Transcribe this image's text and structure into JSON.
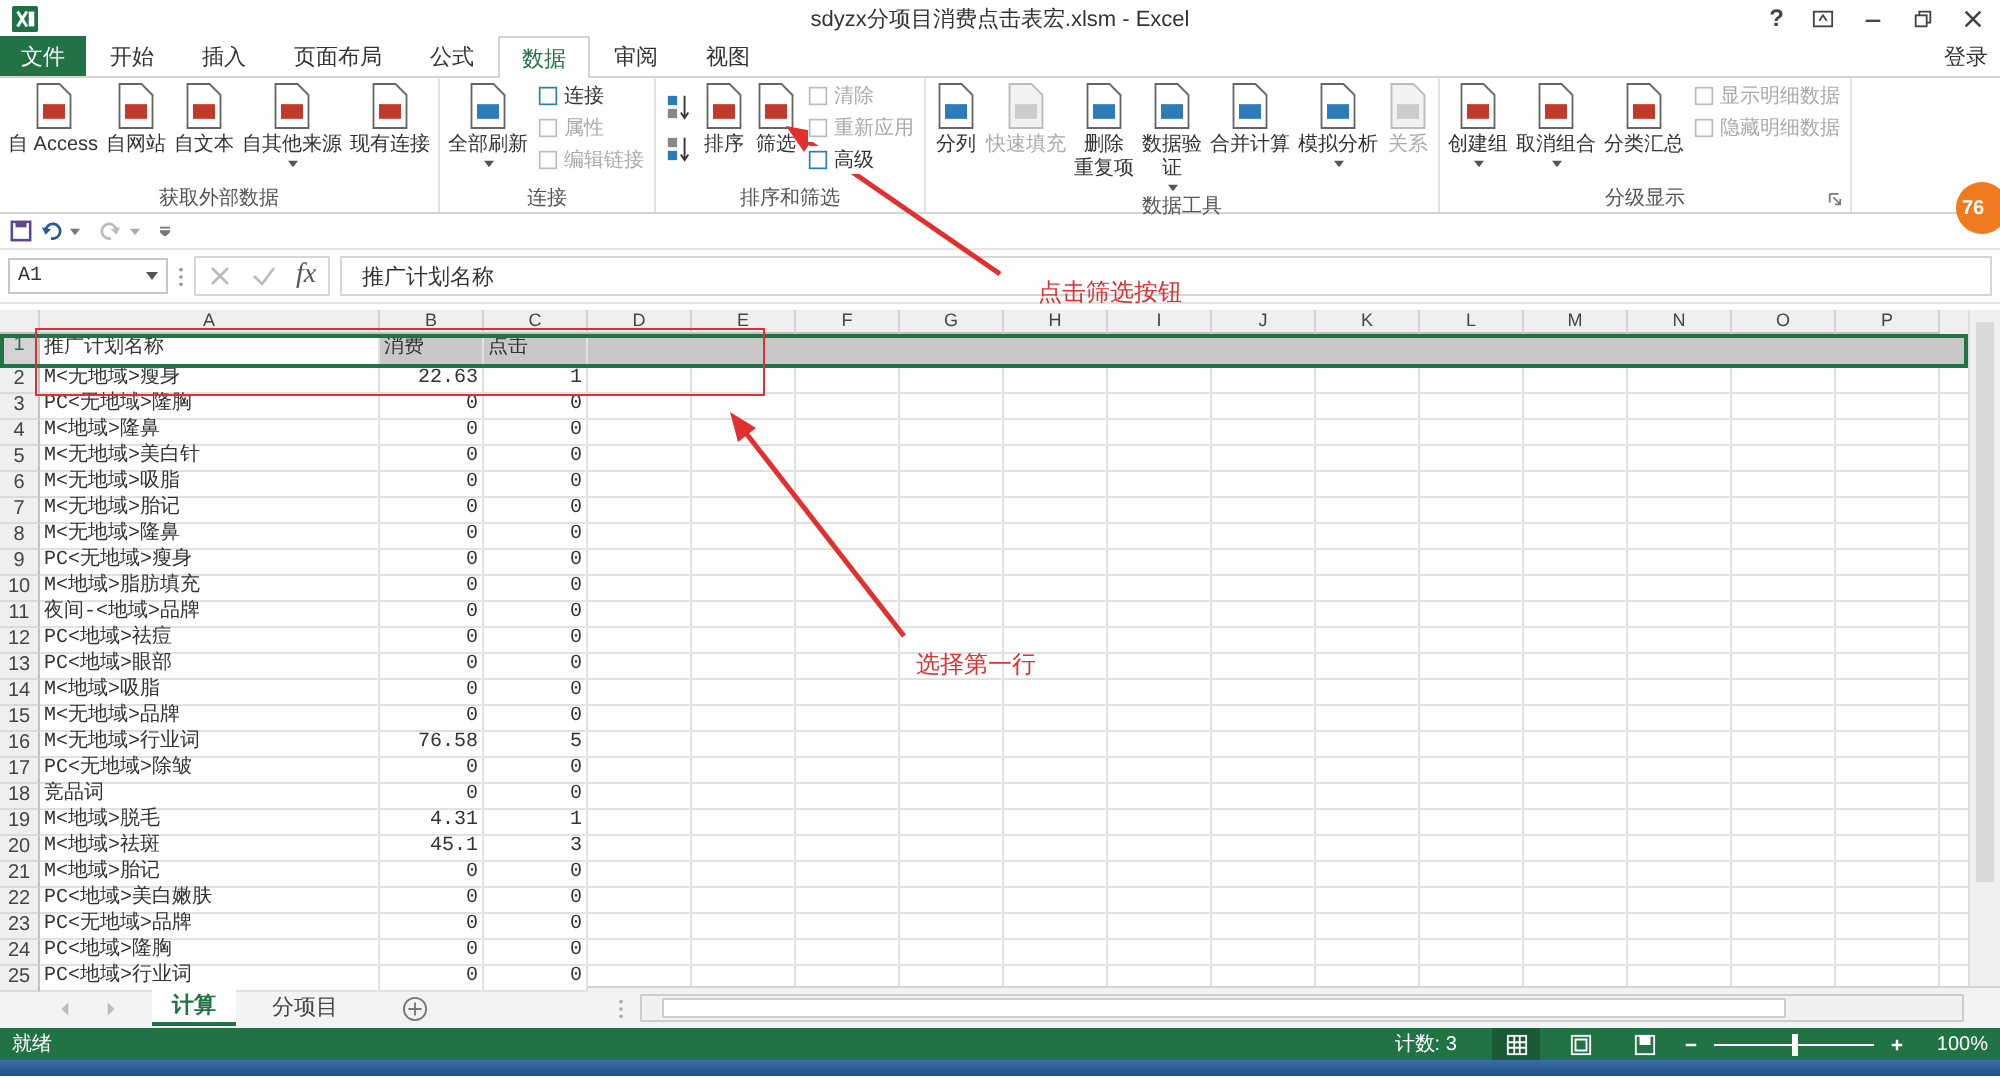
{
  "window": {
    "title": "sdyzx分项目消费点击表宏.xlsm - Excel",
    "help": "?"
  },
  "tabs": [
    {
      "label": "文件",
      "kind": "file",
      "selected": false
    },
    {
      "label": "开始",
      "kind": "tab",
      "selected": false
    },
    {
      "label": "插入",
      "kind": "tab",
      "selected": false
    },
    {
      "label": "页面布局",
      "kind": "tab",
      "selected": false
    },
    {
      "label": "公式",
      "kind": "tab",
      "selected": false
    },
    {
      "label": "数据",
      "kind": "tab",
      "selected": true
    },
    {
      "label": "审阅",
      "kind": "tab",
      "selected": false
    },
    {
      "label": "视图",
      "kind": "tab",
      "selected": false
    }
  ],
  "account": "登录",
  "ribbon": {
    "groups": [
      {
        "label": "获取外部数据",
        "launcher": false,
        "items": [
          {
            "kind": "big",
            "lines": [
              "自 Access"
            ],
            "disabled": false,
            "dropdown": false
          },
          {
            "kind": "big",
            "lines": [
              "自网站"
            ],
            "disabled": false,
            "dropdown": false
          },
          {
            "kind": "big",
            "lines": [
              "自文本"
            ],
            "disabled": false,
            "dropdown": false
          },
          {
            "kind": "big",
            "lines": [
              "自其他来源"
            ],
            "disabled": false,
            "dropdown": true
          },
          {
            "kind": "big",
            "lines": [
              "现有连接"
            ],
            "disabled": false,
            "dropdown": false
          }
        ]
      },
      {
        "label": "连接",
        "launcher": false,
        "items": [
          {
            "kind": "big",
            "lines": [
              "全部刷新"
            ],
            "disabled": false,
            "dropdown": true
          },
          {
            "kind": "stack",
            "entries": [
              {
                "label": "连接",
                "disabled": false
              },
              {
                "label": "属性",
                "disabled": true
              },
              {
                "label": "编辑链接",
                "disabled": true
              }
            ]
          }
        ]
      },
      {
        "label": "排序和筛选",
        "launcher": false,
        "items": [
          {
            "kind": "sort"
          },
          {
            "kind": "big",
            "lines": [
              "排序"
            ],
            "disabled": false,
            "dropdown": false
          },
          {
            "kind": "big",
            "lines": [
              "筛选"
            ],
            "disabled": false,
            "dropdown": false
          },
          {
            "kind": "stack",
            "entries": [
              {
                "label": "清除",
                "disabled": true
              },
              {
                "label": "重新应用",
                "disabled": true
              },
              {
                "label": "高级",
                "disabled": false
              }
            ]
          }
        ]
      },
      {
        "label": "数据工具",
        "launcher": false,
        "items": [
          {
            "kind": "big",
            "lines": [
              "分列"
            ],
            "disabled": false,
            "dropdown": false
          },
          {
            "kind": "big",
            "lines": [
              "快速填充"
            ],
            "disabled": true,
            "dropdown": false
          },
          {
            "kind": "big",
            "lines": [
              "删除",
              "重复项"
            ],
            "disabled": false,
            "dropdown": false
          },
          {
            "kind": "big",
            "lines": [
              "数据验",
              "证"
            ],
            "disabled": false,
            "dropdown": true
          },
          {
            "kind": "big",
            "lines": [
              "合并计算"
            ],
            "disabled": false,
            "dropdown": false
          },
          {
            "kind": "big",
            "lines": [
              "模拟分析"
            ],
            "disabled": false,
            "dropdown": true
          },
          {
            "kind": "big",
            "lines": [
              "关系"
            ],
            "disabled": true,
            "dropdown": false
          }
        ]
      },
      {
        "label": "分级显示",
        "launcher": true,
        "items": [
          {
            "kind": "big",
            "lines": [
              "创建组"
            ],
            "disabled": false,
            "dropdown": true
          },
          {
            "kind": "big",
            "lines": [
              "取消组合"
            ],
            "disabled": false,
            "dropdown": true
          },
          {
            "kind": "big",
            "lines": [
              "分类汇总"
            ],
            "disabled": false,
            "dropdown": false
          },
          {
            "kind": "stack",
            "entries": [
              {
                "label": "显示明细数据",
                "disabled": true
              },
              {
                "label": "隐藏明细数据",
                "disabled": true
              }
            ]
          }
        ]
      }
    ]
  },
  "quick_access": {
    "undo": {
      "disabled": false
    },
    "redo": {
      "disabled": true
    }
  },
  "formula_bar": {
    "name_box": "A1",
    "function_button": "fx",
    "value": "推广计划名称"
  },
  "sheet": {
    "columns": [
      "A",
      "B",
      "C",
      "D",
      "E",
      "F",
      "G",
      "H",
      "I",
      "J",
      "K",
      "L",
      "M",
      "N",
      "O",
      "P"
    ],
    "rows": [
      {
        "number": "1",
        "kind": "header",
        "selected": true,
        "cells": [
          "推广计划名称",
          "消费",
          "点击"
        ]
      },
      {
        "number": "2",
        "kind": "data",
        "selected": false,
        "cells": [
          "M<无地域>瘦身",
          "22.63",
          "1"
        ]
      },
      {
        "number": "3",
        "kind": "data",
        "selected": false,
        "cells": [
          "PC<无地域>隆胸",
          "0",
          "0"
        ]
      },
      {
        "number": "4",
        "kind": "data",
        "selected": false,
        "cells": [
          "M<地域>隆鼻",
          "0",
          "0"
        ]
      },
      {
        "number": "5",
        "kind": "data",
        "selected": false,
        "cells": [
          "M<无地域>美白针",
          "0",
          "0"
        ]
      },
      {
        "number": "6",
        "kind": "data",
        "selected": false,
        "cells": [
          "M<无地域>吸脂",
          "0",
          "0"
        ]
      },
      {
        "number": "7",
        "kind": "data",
        "selected": false,
        "cells": [
          "M<无地域>胎记",
          "0",
          "0"
        ]
      },
      {
        "number": "8",
        "kind": "data",
        "selected": false,
        "cells": [
          "M<无地域>隆鼻",
          "0",
          "0"
        ]
      },
      {
        "number": "9",
        "kind": "data",
        "selected": false,
        "cells": [
          "PC<无地域>瘦身",
          "0",
          "0"
        ]
      },
      {
        "number": "10",
        "kind": "data",
        "selected": false,
        "cells": [
          "M<地域>脂肪填充",
          "0",
          "0"
        ]
      },
      {
        "number": "11",
        "kind": "data",
        "selected": false,
        "cells": [
          "夜间-<地域>品牌",
          "0",
          "0"
        ]
      },
      {
        "number": "12",
        "kind": "data",
        "selected": false,
        "cells": [
          "PC<地域>祛痘",
          "0",
          "0"
        ]
      },
      {
        "number": "13",
        "kind": "data",
        "selected": false,
        "cells": [
          "PC<地域>眼部",
          "0",
          "0"
        ]
      },
      {
        "number": "14",
        "kind": "data",
        "selected": false,
        "cells": [
          "M<地域>吸脂",
          "0",
          "0"
        ]
      },
      {
        "number": "15",
        "kind": "data",
        "selected": false,
        "cells": [
          "M<无地域>品牌",
          "0",
          "0"
        ]
      },
      {
        "number": "16",
        "kind": "data",
        "selected": false,
        "cells": [
          "M<无地域>行业词",
          "76.58",
          "5"
        ]
      },
      {
        "number": "17",
        "kind": "data",
        "selected": false,
        "cells": [
          "PC<无地域>除皱",
          "0",
          "0"
        ]
      },
      {
        "number": "18",
        "kind": "data",
        "selected": false,
        "cells": [
          "竞品词",
          "0",
          "0"
        ]
      },
      {
        "number": "19",
        "kind": "data",
        "selected": false,
        "cells": [
          "M<地域>脱毛",
          "4.31",
          "1"
        ]
      },
      {
        "number": "20",
        "kind": "data",
        "selected": false,
        "cells": [
          "M<地域>祛斑",
          "45.1",
          "3"
        ]
      },
      {
        "number": "21",
        "kind": "data",
        "selected": false,
        "cells": [
          "M<地域>胎记",
          "0",
          "0"
        ]
      },
      {
        "number": "22",
        "kind": "data",
        "selected": false,
        "cells": [
          "PC<地域>美白嫩肤",
          "0",
          "0"
        ]
      },
      {
        "number": "23",
        "kind": "data",
        "selected": false,
        "cells": [
          "PC<无地域>品牌",
          "0",
          "0"
        ]
      },
      {
        "number": "24",
        "kind": "data",
        "selected": false,
        "cells": [
          "PC<地域>隆胸",
          "0",
          "0"
        ]
      },
      {
        "number": "25",
        "kind": "data",
        "selected": false,
        "cells": [
          "PC<地域>行业词",
          "0",
          "0"
        ]
      }
    ]
  },
  "sheet_tabs": [
    {
      "label": "计算",
      "selected": true
    },
    {
      "label": "分项目",
      "selected": false
    }
  ],
  "status_bar": {
    "status": "就绪",
    "summary": "计数: 3",
    "view_buttons": [
      {
        "selected": true
      },
      {
        "selected": false
      },
      {
        "selected": false
      }
    ],
    "zoom": {
      "level": 0.5,
      "reading": "100%"
    }
  },
  "annotations": [
    {
      "text": "点击筛选按钮"
    },
    {
      "text": "选择第一行"
    }
  ],
  "badge": "76"
}
